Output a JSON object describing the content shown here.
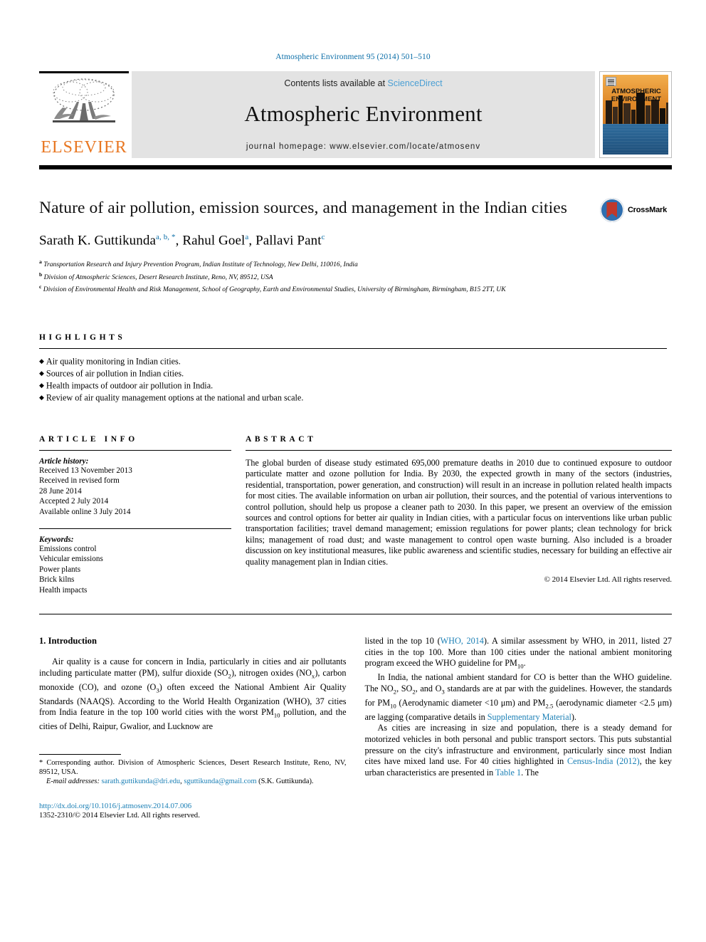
{
  "running_head": "Atmospheric Environment 95 (2014) 501–510",
  "masthead": {
    "elsevier_logo_text": "ELSEVIER",
    "contents_prefix": "Contents lists available at ",
    "contents_link": "ScienceDirect",
    "journal_name": "Atmospheric Environment",
    "homepage": "journal homepage: www.elsevier.com/locate/atmosenv",
    "cover_title_line1": "ATMOSPHERIC",
    "cover_title_line2": "ENVIRONMENT"
  },
  "article": {
    "title": "Nature of air pollution, emission sources, and management in the Indian cities",
    "authors_plain": "Sarath K. Guttikunda a, b, *, Rahul Goel a, Pallavi Pant c",
    "authors": [
      {
        "name": "Sarath K. Guttikunda",
        "marks": "a, b, *"
      },
      {
        "name": "Rahul Goel",
        "marks": "a"
      },
      {
        "name": "Pallavi Pant",
        "marks": "c"
      }
    ],
    "affiliations": [
      {
        "mark": "a",
        "text": "Transportation Research and Injury Prevention Program, Indian Institute of Technology, New Delhi, 110016, India"
      },
      {
        "mark": "b",
        "text": "Division of Atmospheric Sciences, Desert Research Institute, Reno, NV, 89512, USA"
      },
      {
        "mark": "c",
        "text": "Division of Environmental Health and Risk Management, School of Geography, Earth and Environmental Studies, University of Birmingham, Birmingham, B15 2TT, UK"
      }
    ],
    "crossmark_label": "CrossMark"
  },
  "highlights": {
    "heading": "HIGHLIGHTS",
    "items": [
      "Air quality monitoring in Indian cities.",
      "Sources of air pollution in Indian cities.",
      "Health impacts of outdoor air pollution in India.",
      "Review of air quality management options at the national and urban scale."
    ]
  },
  "article_info": {
    "heading": "ARTICLE INFO",
    "history_label": "Article history:",
    "history_lines": [
      "Received 13 November 2013",
      "Received in revised form",
      "28 June 2014",
      "Accepted 2 July 2014",
      "Available online 3 July 2014"
    ],
    "keywords_label": "Keywords:",
    "keywords": [
      "Emissions control",
      "Vehicular emissions",
      "Power plants",
      "Brick kilns",
      "Health impacts"
    ]
  },
  "abstract": {
    "heading": "ABSTRACT",
    "text": "The global burden of disease study estimated 695,000 premature deaths in 2010 due to continued exposure to outdoor particulate matter and ozone pollution for India. By 2030, the expected growth in many of the sectors (industries, residential, transportation, power generation, and construction) will result in an increase in pollution related health impacts for most cities. The available information on urban air pollution, their sources, and the potential of various interventions to control pollution, should help us propose a cleaner path to 2030. In this paper, we present an overview of the emission sources and control options for better air quality in Indian cities, with a particular focus on interventions like urban public transportation facilities; travel demand management; emission regulations for power plants; clean technology for brick kilns; management of road dust; and waste management to control open waste burning. Also included is a broader discussion on key institutional measures, like public awareness and scientific studies, necessary for building an effective air quality management plan in Indian cities.",
    "copyright": "© 2014 Elsevier Ltd. All rights reserved."
  },
  "introduction": {
    "heading": "1. Introduction",
    "left_para_1_a": "Air quality is a cause for concern in India, particularly in cities and air pollutants including particulate matter (PM), sulfur dioxide (SO",
    "left_para_1_b": "), nitrogen oxides (NO",
    "left_para_1_c": "), carbon monoxide (CO), and ozone (O",
    "left_para_1_d": ") often exceed the National Ambient Air Quality Standards (NAAQS). According to the World Health Organization (WHO), 37 cities from India feature in the top 100 world cities with the worst PM",
    "left_para_1_e": " pollution, and the cities of Delhi, Raipur, Gwalior, and Lucknow are",
    "right_p1_a": "listed in the top 10 (",
    "right_p1_link": "WHO, 2014",
    "right_p1_b": "). A similar assessment by WHO, in 2011, listed 27 cities in the top 100. More than 100 cities under the national ambient monitoring program exceed the WHO guideline for PM",
    "right_p1_c": ".",
    "right_p2_a": "In India, the national ambient standard for CO is better than the WHO guideline. The NO",
    "right_p2_b": ", SO",
    "right_p2_c": ", and O",
    "right_p2_d": " standards are at par with the guidelines. However, the standards for PM",
    "right_p2_e": " (Aerodynamic diameter <10 μm) and PM",
    "right_p2_f": " (aerodynamic diameter <2.5 μm) are lagging (comparative details in ",
    "right_p2_link": "Supplementary Material",
    "right_p2_g": ").",
    "right_p3_a": "As cities are increasing in size and population, there is a steady demand for motorized vehicles in both personal and public transport sectors. This puts substantial pressure on the city's infrastructure and environment, particularly since most Indian cites have mixed land use. For 40 cities highlighted in ",
    "right_p3_link1": "Census-India (2012)",
    "right_p3_b": ", the key urban characteristics are presented in ",
    "right_p3_link2": "Table 1",
    "right_p3_c": ". The"
  },
  "footer": {
    "corresponding_star": "*",
    "corresponding_text": " Corresponding author. Division of Atmospheric Sciences, Desert Research Institute, Reno, NV, 89512, USA.",
    "email_label": "E-mail addresses:",
    "email_1": "sarath.guttikunda@dri.edu",
    "email_sep": ", ",
    "email_2": "sguttikunda@gmail.com",
    "email_owner": "(S.K. Guttikunda).",
    "doi": "http://dx.doi.org/10.1016/j.atmosenv.2014.07.006",
    "issn": "1352-2310/© 2014 Elsevier Ltd. All rights reserved."
  },
  "colors": {
    "link": "#1a7fb5",
    "running_head": "#0b6ea8",
    "elsevier_orange": "#E87722",
    "masthead_grey": "#e3e3e3"
  }
}
